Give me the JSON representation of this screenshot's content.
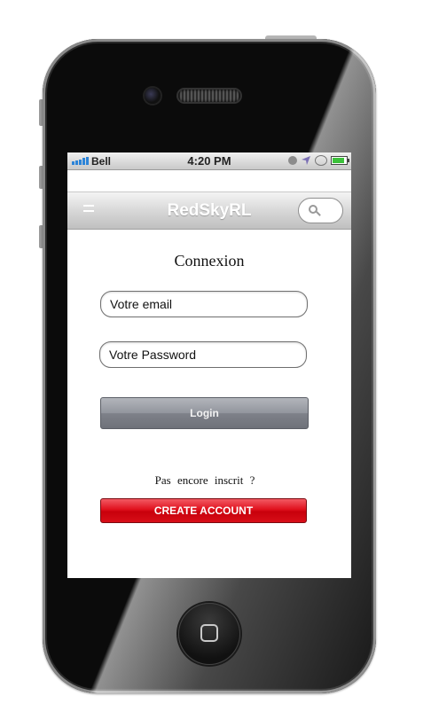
{
  "status_bar": {
    "carrier": "Bell",
    "time": "4:20 PM",
    "icons": [
      "signal-icon",
      "clock-icon",
      "location-arrow-icon",
      "rotation-lock-icon",
      "battery-icon"
    ]
  },
  "header": {
    "title": "RedSkyRL",
    "menu_icon": "menu-icon",
    "search_icon": "search-icon"
  },
  "login": {
    "title": "Connexion",
    "email_placeholder": "Votre email",
    "password_placeholder": "Votre Password",
    "login_label": "Login"
  },
  "signup": {
    "prompt": "Pas encore inscrit ?",
    "create_label": "CREATE ACCOUNT"
  },
  "colors": {
    "create_button": "#e0101c",
    "login_button": "#92959d",
    "signal": "#2c84d8",
    "battery": "#3cc13b"
  }
}
